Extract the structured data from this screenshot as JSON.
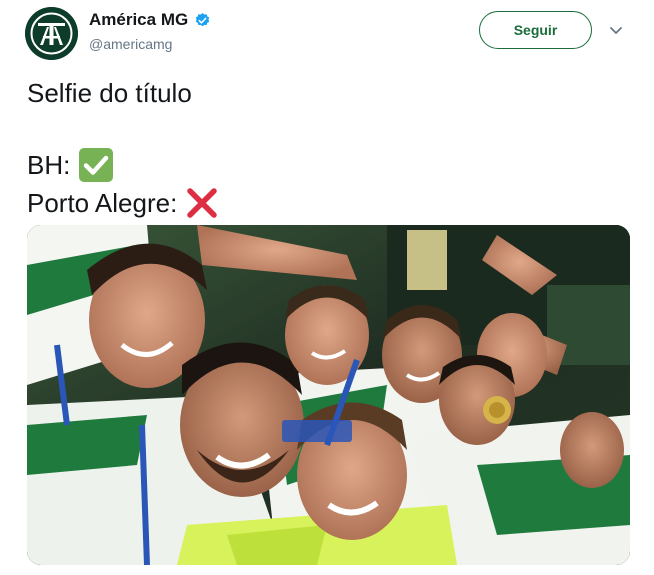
{
  "tweet": {
    "author": {
      "display_name": "América MG",
      "handle": "@americamg",
      "verified": true,
      "avatar_icon": "america-mg-crest-icon"
    },
    "follow_label": "Seguir",
    "menu_icon": "chevron-down-icon",
    "text": {
      "line1": "Selfie do título",
      "line2_label": "BH:",
      "line2_emoji": "check-mark-button-icon",
      "line3_label": "Porto Alegre:",
      "line3_emoji": "cross-mark-icon"
    },
    "media": {
      "type": "photo",
      "photo_icon": "team-selfie-photo"
    }
  },
  "colors": {
    "brand_green": "#1a6d3b",
    "text_primary": "#14171a",
    "text_secondary": "#657786",
    "verified_blue": "#1da1f2",
    "check_green": "#77b255",
    "cross_red": "#dd2e44"
  }
}
